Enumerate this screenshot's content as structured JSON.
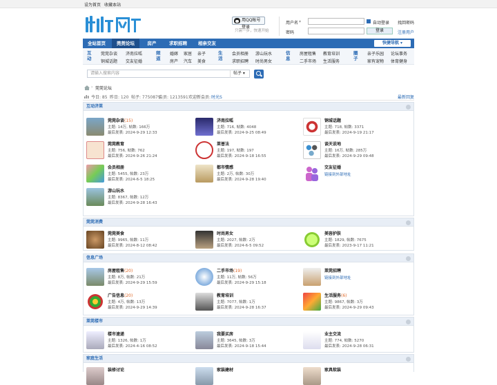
{
  "topbar": {
    "set_home": "设为首页",
    "bookmark": "收藏本站"
  },
  "qq_login": {
    "label": "用QQ帐号登录",
    "sub": "只需一步，快速开始"
  },
  "login": {
    "username_label": "用户名",
    "password_label": "密码",
    "remember": "自动登录",
    "find_password": "找回密码",
    "login_button": "登录",
    "register": "注册用户"
  },
  "nav": {
    "items": [
      "全站首页",
      "莞莞论坛",
      "房产",
      "求职招聘",
      "相亲交友"
    ],
    "quick": "快捷导航"
  },
  "subnav": [
    {
      "title": "互动",
      "items": [
        "莞莞杂谈",
        "济南拉呱",
        "铜城话题",
        "交友征婚"
      ]
    },
    {
      "title": "频道",
      "items": [
        "婚嫁",
        "家居",
        "亲子",
        "房产",
        "汽车",
        "美食"
      ]
    },
    {
      "title": "生活",
      "items": [
        "会员相册",
        "游山玩水",
        "求职招聘",
        "时尚男女"
      ]
    },
    {
      "title": "信息",
      "items": [
        "房屋租售",
        "教育培训",
        "二手市场",
        "生活服务"
      ]
    },
    {
      "title": "圈子",
      "items": [
        "亲子乐园",
        "论坛事务",
        "家有宠物",
        "体育健身"
      ]
    }
  ],
  "search": {
    "placeholder": "请输入搜索内容",
    "scope": "帖子"
  },
  "breadcrumb": {
    "current": "莞莞论坛"
  },
  "stats": {
    "today": "今日: 85",
    "yesterday": "昨日: 120",
    "posts": "帖子: 7750879",
    "members": "会员: 1213591",
    "welcome": "欢迎新会员:",
    "new_member": "时光S",
    "latest": "最新回复"
  },
  "sections": [
    {
      "title": "互动济莱",
      "forums": [
        {
          "name": "莞莞杂谈",
          "today": "(15)",
          "stats": "主题: 14万, 帖数: 166万",
          "last": "最后发表: 2024-9-29 12:33"
        },
        {
          "name": "济南拉呱",
          "today": "",
          "stats": "主题: 716, 帖数: 4048",
          "last": "最后发表: 2024-9-25 08:49"
        },
        {
          "name": "铜城话题",
          "today": "",
          "stats": "主题: 718, 帖数: 3371",
          "last": "最后发表: 2024-9-19 21:17"
        },
        {
          "name": "莞莞教育",
          "today": "",
          "stats": "主题: 756, 帖数: 762",
          "last": "最后发表: 2024-9-26 21:24"
        },
        {
          "name": "莱普法",
          "today": "",
          "stats": "主题: 197, 帖数: 197",
          "last": "最后发表: 2024-9-18 16:55"
        },
        {
          "name": "谈天说地",
          "today": "",
          "stats": "主题: 16万, 帖数: 285万",
          "last": "最后发表: 2024-9-29 09:48"
        },
        {
          "name": "会员相册",
          "today": "",
          "stats": "主题: 5455, 帖数: 23万",
          "last": "最后发表: 2024-6-5 18:25"
        },
        {
          "name": "都市情感",
          "today": "",
          "stats": "主题: 2万, 帖数: 30万",
          "last": "最后发表: 2024-9-28 19:40"
        },
        {
          "name": "交友征婚",
          "today": "",
          "link": "链接到外部地址"
        },
        {
          "name": "游山玩水",
          "today": "",
          "stats": "主题: 8367, 帖数: 12万",
          "last": "最后发表: 2024-9-28 16:43"
        }
      ]
    },
    {
      "title": "莞莞消费",
      "forums": [
        {
          "name": "莞莞美食",
          "today": "",
          "stats": "主题: 9965, 帖数: 11万",
          "last": "最后发表: 2024-8-12 08:42"
        },
        {
          "name": "时尚男女",
          "today": "",
          "stats": "主题: 2027, 帖数: 2万",
          "last": "最后发表: 2024-6-5 09:52"
        },
        {
          "name": "美容护肤",
          "today": "",
          "stats": "主题: 1829, 帖数: 7675",
          "last": "最后发表: 2023-9-17 11:21"
        }
      ]
    },
    {
      "title": "信息广场",
      "forums": [
        {
          "name": "房屋租售",
          "today": "(20)",
          "stats": "主题: 8万, 帖数: 21万",
          "last": "最后发表: 2024-9-29 15:59"
        },
        {
          "name": "二手市场",
          "today": "(19)",
          "stats": "主题: 11万, 帖数: 56万",
          "last": "最后发表: 2024-9-29 15:18"
        },
        {
          "name": "莱莞招聘",
          "today": "",
          "link": "链接到外部地址"
        },
        {
          "name": "广告信息",
          "today": "(20)",
          "stats": "主题: 4万, 帖数: 13万",
          "last": "最后发表: 2024-9-29 14:39"
        },
        {
          "name": "教育培训",
          "today": "",
          "stats": "主题: 7077, 帖数: 1万",
          "last": "最后发表: 2024-9-28 16:37"
        },
        {
          "name": "生活服务",
          "today": "(6)",
          "stats": "主题: 9867, 帖数: 3万",
          "last": "最后发表: 2024-9-29 09:43"
        }
      ]
    },
    {
      "title": "莱莞楼市",
      "forums": [
        {
          "name": "楼市速递",
          "today": "",
          "stats": "主题: 1326, 帖数: 1万",
          "last": "最后发表: 2024-4-16 08:52"
        },
        {
          "name": "我要买房",
          "today": "",
          "stats": "主题: 3645, 帖数: 3万",
          "last": "最后发表: 2024-9-18 15:44"
        },
        {
          "name": "业主交流",
          "today": "",
          "stats": "主题: 774, 帖数: 5270",
          "last": "最后发表: 2024-9-28 06:31"
        }
      ]
    },
    {
      "title": "家庭生活",
      "forums": [
        {
          "name": "装修讨论",
          "today": ""
        },
        {
          "name": "家装建材",
          "today": ""
        },
        {
          "name": "家具软装",
          "today": ""
        }
      ]
    }
  ],
  "colors": {
    "brand": "#2d6cb5",
    "nav_active": "#1d4f8c",
    "section_bg": "#e8eef6",
    "today": "#e06a2a"
  }
}
